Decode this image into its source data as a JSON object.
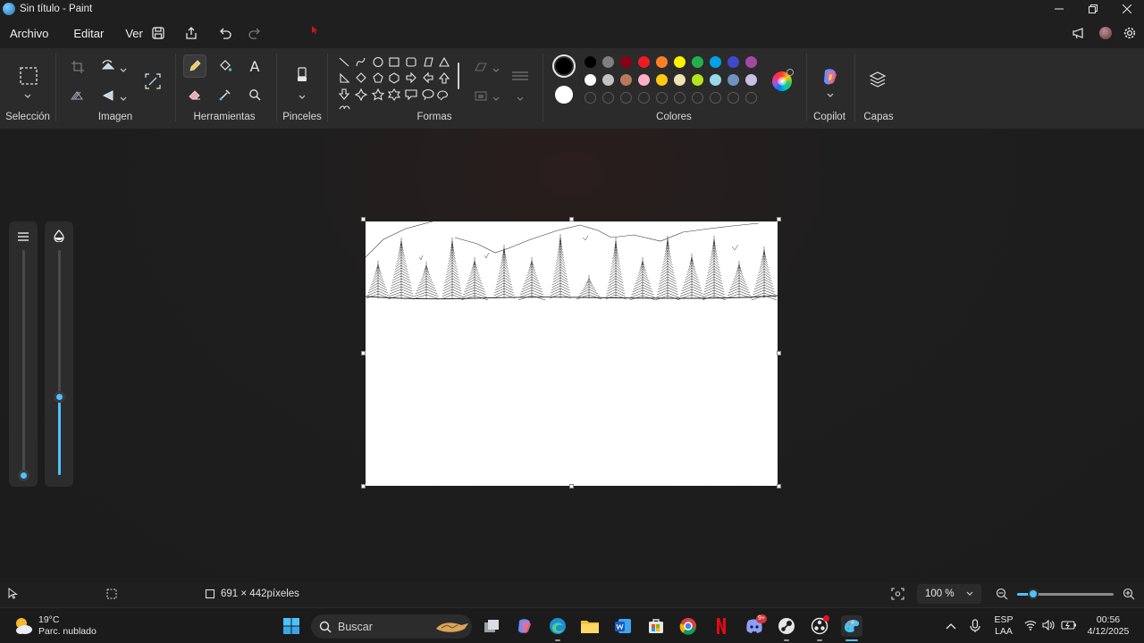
{
  "window": {
    "title": "Sin título - Paint"
  },
  "menu": {
    "items": [
      "Archivo",
      "Editar",
      "Ver"
    ]
  },
  "ribbon": {
    "groups": {
      "seleccion": "Selección",
      "imagen": "Imagen",
      "herramientas": "Herramientas",
      "pinceles": "Pinceles",
      "formas": "Formas",
      "colores": "Colores",
      "copilot": "Copilot",
      "capas": "Capas"
    },
    "text_tool_glyph": "A",
    "active_tool": "pencil"
  },
  "colors": {
    "primary": "#000000",
    "secondary": "#ffffff",
    "row1": [
      "#000000",
      "#7f7f7f",
      "#880015",
      "#ed1c24",
      "#ff7f27",
      "#fff200",
      "#22b14c",
      "#00a2e8",
      "#3f48cc",
      "#a349a4"
    ],
    "row2": [
      "#ffffff",
      "#c3c3c3",
      "#b97a57",
      "#ffaec9",
      "#ffc90e",
      "#efe4b0",
      "#b5e61d",
      "#99d9ea",
      "#7092be",
      "#c8bfe7"
    ],
    "row3_empty_count": 10
  },
  "sliders": {
    "size_value": 0.0,
    "opacity_value": 0.35
  },
  "status": {
    "canvas_size": "691 × 442píxeles",
    "zoom": "100 %",
    "zoom_slider_value": 0.17
  },
  "taskbar": {
    "weather_temp": "19°C",
    "weather_desc": "Parc. nublado",
    "search_placeholder": "Buscar",
    "lang_top": "ESP",
    "lang_bottom": "LAA",
    "time": "00:56",
    "date": "4/12/2025",
    "discord_badge": "9+"
  }
}
